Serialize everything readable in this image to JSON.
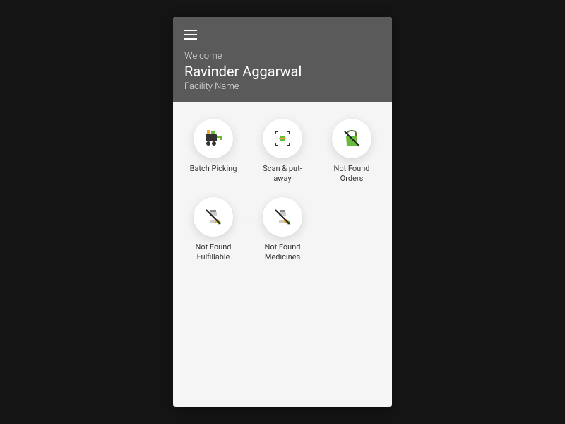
{
  "header": {
    "welcome_label": "Welcome",
    "user_name": "Ravinder Aggarwal",
    "facility_name": "Facility Name"
  },
  "tiles": [
    {
      "id": "batch-picking",
      "label": "Batch Picking",
      "icon": "cart-icon"
    },
    {
      "id": "scan-put-away",
      "label": "Scan & put-away",
      "icon": "scan-icon"
    },
    {
      "id": "not-found-orders",
      "label": "Not Found Orders",
      "icon": "bag-slash-icon"
    },
    {
      "id": "not-found-fulfillable",
      "label": "Not Found\nFulfillable",
      "icon": "bottle-slash-icon"
    },
    {
      "id": "not-found-medicines",
      "label": "Not Found\nMedicines",
      "icon": "bottle-slash-icon"
    }
  ],
  "colors": {
    "header_bg": "#5a5a5a",
    "accent_green": "#66bb3a",
    "accent_orange": "#f5a623",
    "body_bg": "#f5f5f5"
  }
}
